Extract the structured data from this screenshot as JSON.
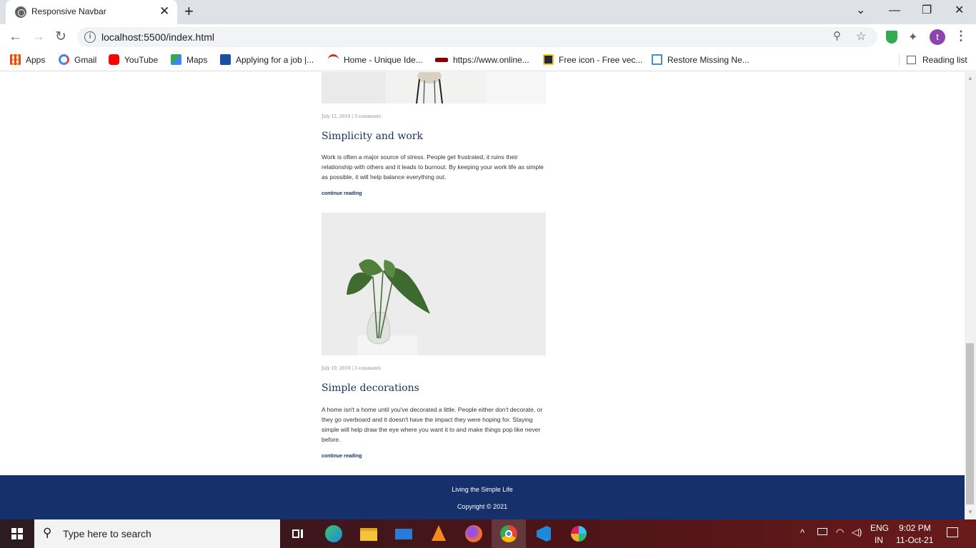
{
  "browser": {
    "tab_title": "Responsive Navbar",
    "tab_close": "✕",
    "new_tab": "+",
    "url": "localhost:5500/index.html",
    "window_controls": [
      "⌄",
      "—",
      "❐",
      "✕"
    ],
    "profile_initial": "t",
    "bookmarks": [
      {
        "label": "Apps",
        "icon": "apps-grid-icon",
        "color": "#ea4335"
      },
      {
        "label": "Gmail",
        "icon": "google-icon",
        "color": "#4285f4"
      },
      {
        "label": "YouTube",
        "icon": "youtube-icon",
        "color": "#ff0000"
      },
      {
        "label": "Maps",
        "icon": "maps-icon",
        "color": "#34a853"
      },
      {
        "label": "Applying for a job |...",
        "icon": "c-icon",
        "color": "#1a4fa0"
      },
      {
        "label": "Home - Unique Ide...",
        "icon": "wifi-red-icon",
        "color": "#c0392b"
      },
      {
        "label": "https://www.online...",
        "icon": "nsdl-icon",
        "color": "#8b0000"
      },
      {
        "label": "Free icon - Free vec...",
        "icon": "flaticon-icon",
        "color": "#1f2b3a"
      },
      {
        "label": "Restore Missing Ne...",
        "icon": "monitor-icon",
        "color": "#4a90c2"
      }
    ],
    "reading_list": "Reading list"
  },
  "posts": [
    {
      "meta": "July 12, 2019 | 3 comments",
      "title": "Simplicity and work",
      "body": "Work is often a major source of stress. People get frustrated, it ruins their relationship with others and it leads to burnout. By keeping your work life as simple as possible, it will help balance everything out.",
      "link": "continue reading"
    },
    {
      "meta": "July 19, 2019 | 3 comments",
      "title": "Simple decorations",
      "body": "A home isn't a home until you've decorated a little. People either don't decorate, or they go overboard and it doesn't have the impact they were hoping for. Staying simple will help draw the eye where you want it to and make things pop like never before.",
      "link": "continue reading"
    }
  ],
  "footer": {
    "tagline": "Living the Simple Life",
    "copyright": "Copyright © 2021"
  },
  "taskbar": {
    "search_placeholder": "Type here to search",
    "apps": [
      "task-view-icon",
      "edge-icon",
      "file-explorer-icon",
      "mail-icon",
      "vlc-icon",
      "firefox-icon",
      "chrome-icon",
      "vscode-icon",
      "slack-icon"
    ],
    "lang_top": "ENG",
    "lang_bottom": "IN",
    "time": "9:02 PM",
    "date": "11-Oct-21"
  }
}
